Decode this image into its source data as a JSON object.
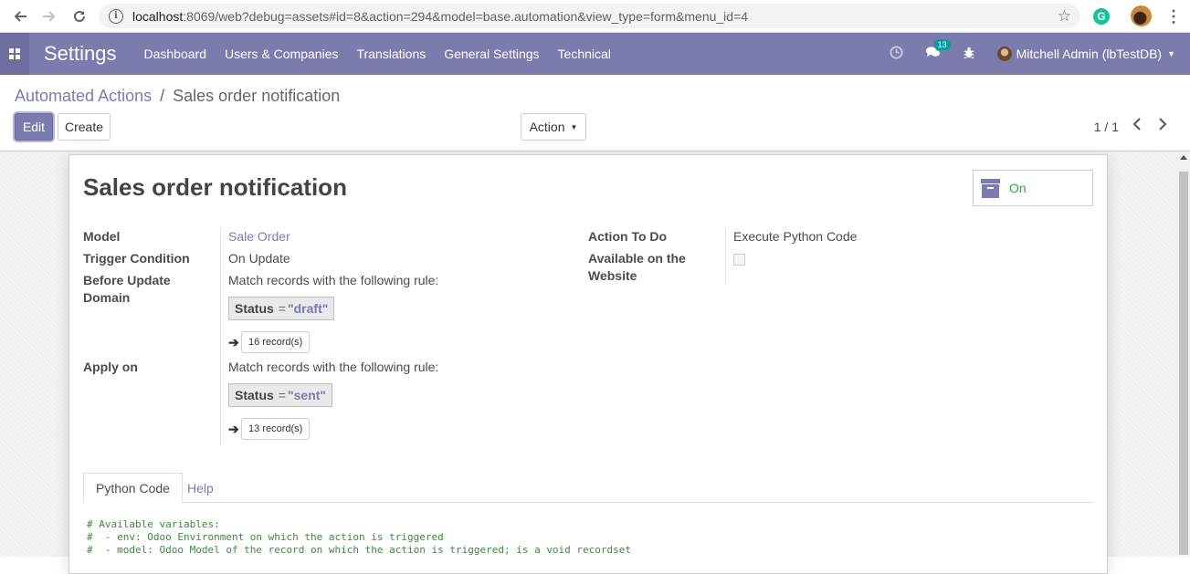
{
  "browser": {
    "url_host": "localhost",
    "url_rest": ":8069/web?debug=assets#id=8&action=294&model=base.automation&view_type=form&menu_id=4",
    "grammarly_label": "G"
  },
  "navbar": {
    "app_name": "Settings",
    "menu": [
      "Dashboard",
      "Users & Companies",
      "Translations",
      "General Settings",
      "Technical"
    ],
    "chat_count": "13",
    "user_name": "Mitchell Admin (lbTestDB)"
  },
  "control": {
    "breadcrumb_root": "Automated Actions",
    "breadcrumb_sep": "/",
    "breadcrumb_current": "Sales order notification",
    "edit_label": "Edit",
    "create_label": "Create",
    "action_label": "Action",
    "pager": "1 / 1"
  },
  "form": {
    "title": "Sales order notification",
    "status_button": "On",
    "model_label": "Model",
    "model_value": "Sale Order",
    "trigger_label": "Trigger Condition",
    "trigger_value": "On Update",
    "before_domain_label_1": "Before Update",
    "before_domain_label_2": "Domain",
    "rule_text": "Match records with the following rule:",
    "before_facet_field": "Status",
    "before_facet_op": "=",
    "before_facet_value": "\"draft\"",
    "before_records": "16 record(s)",
    "apply_label": "Apply on",
    "apply_rule_text": "Match records with the following rule:",
    "apply_facet_field": "Status",
    "apply_facet_op": "=",
    "apply_facet_value": "\"sent\"",
    "apply_records": "13 record(s)",
    "action_label": "Action To Do",
    "action_value": "Execute Python Code",
    "website_label_1": "Available on the",
    "website_label_2": "Website",
    "website_checked": false
  },
  "tabs": [
    "Python Code",
    "Help"
  ],
  "code_lines": [
    "# Available variables:",
    "#  - env: Odoo Environment on which the action is triggered",
    "#  - model: Odoo Model of the record on which the action is triggered; is a void recordset"
  ]
}
